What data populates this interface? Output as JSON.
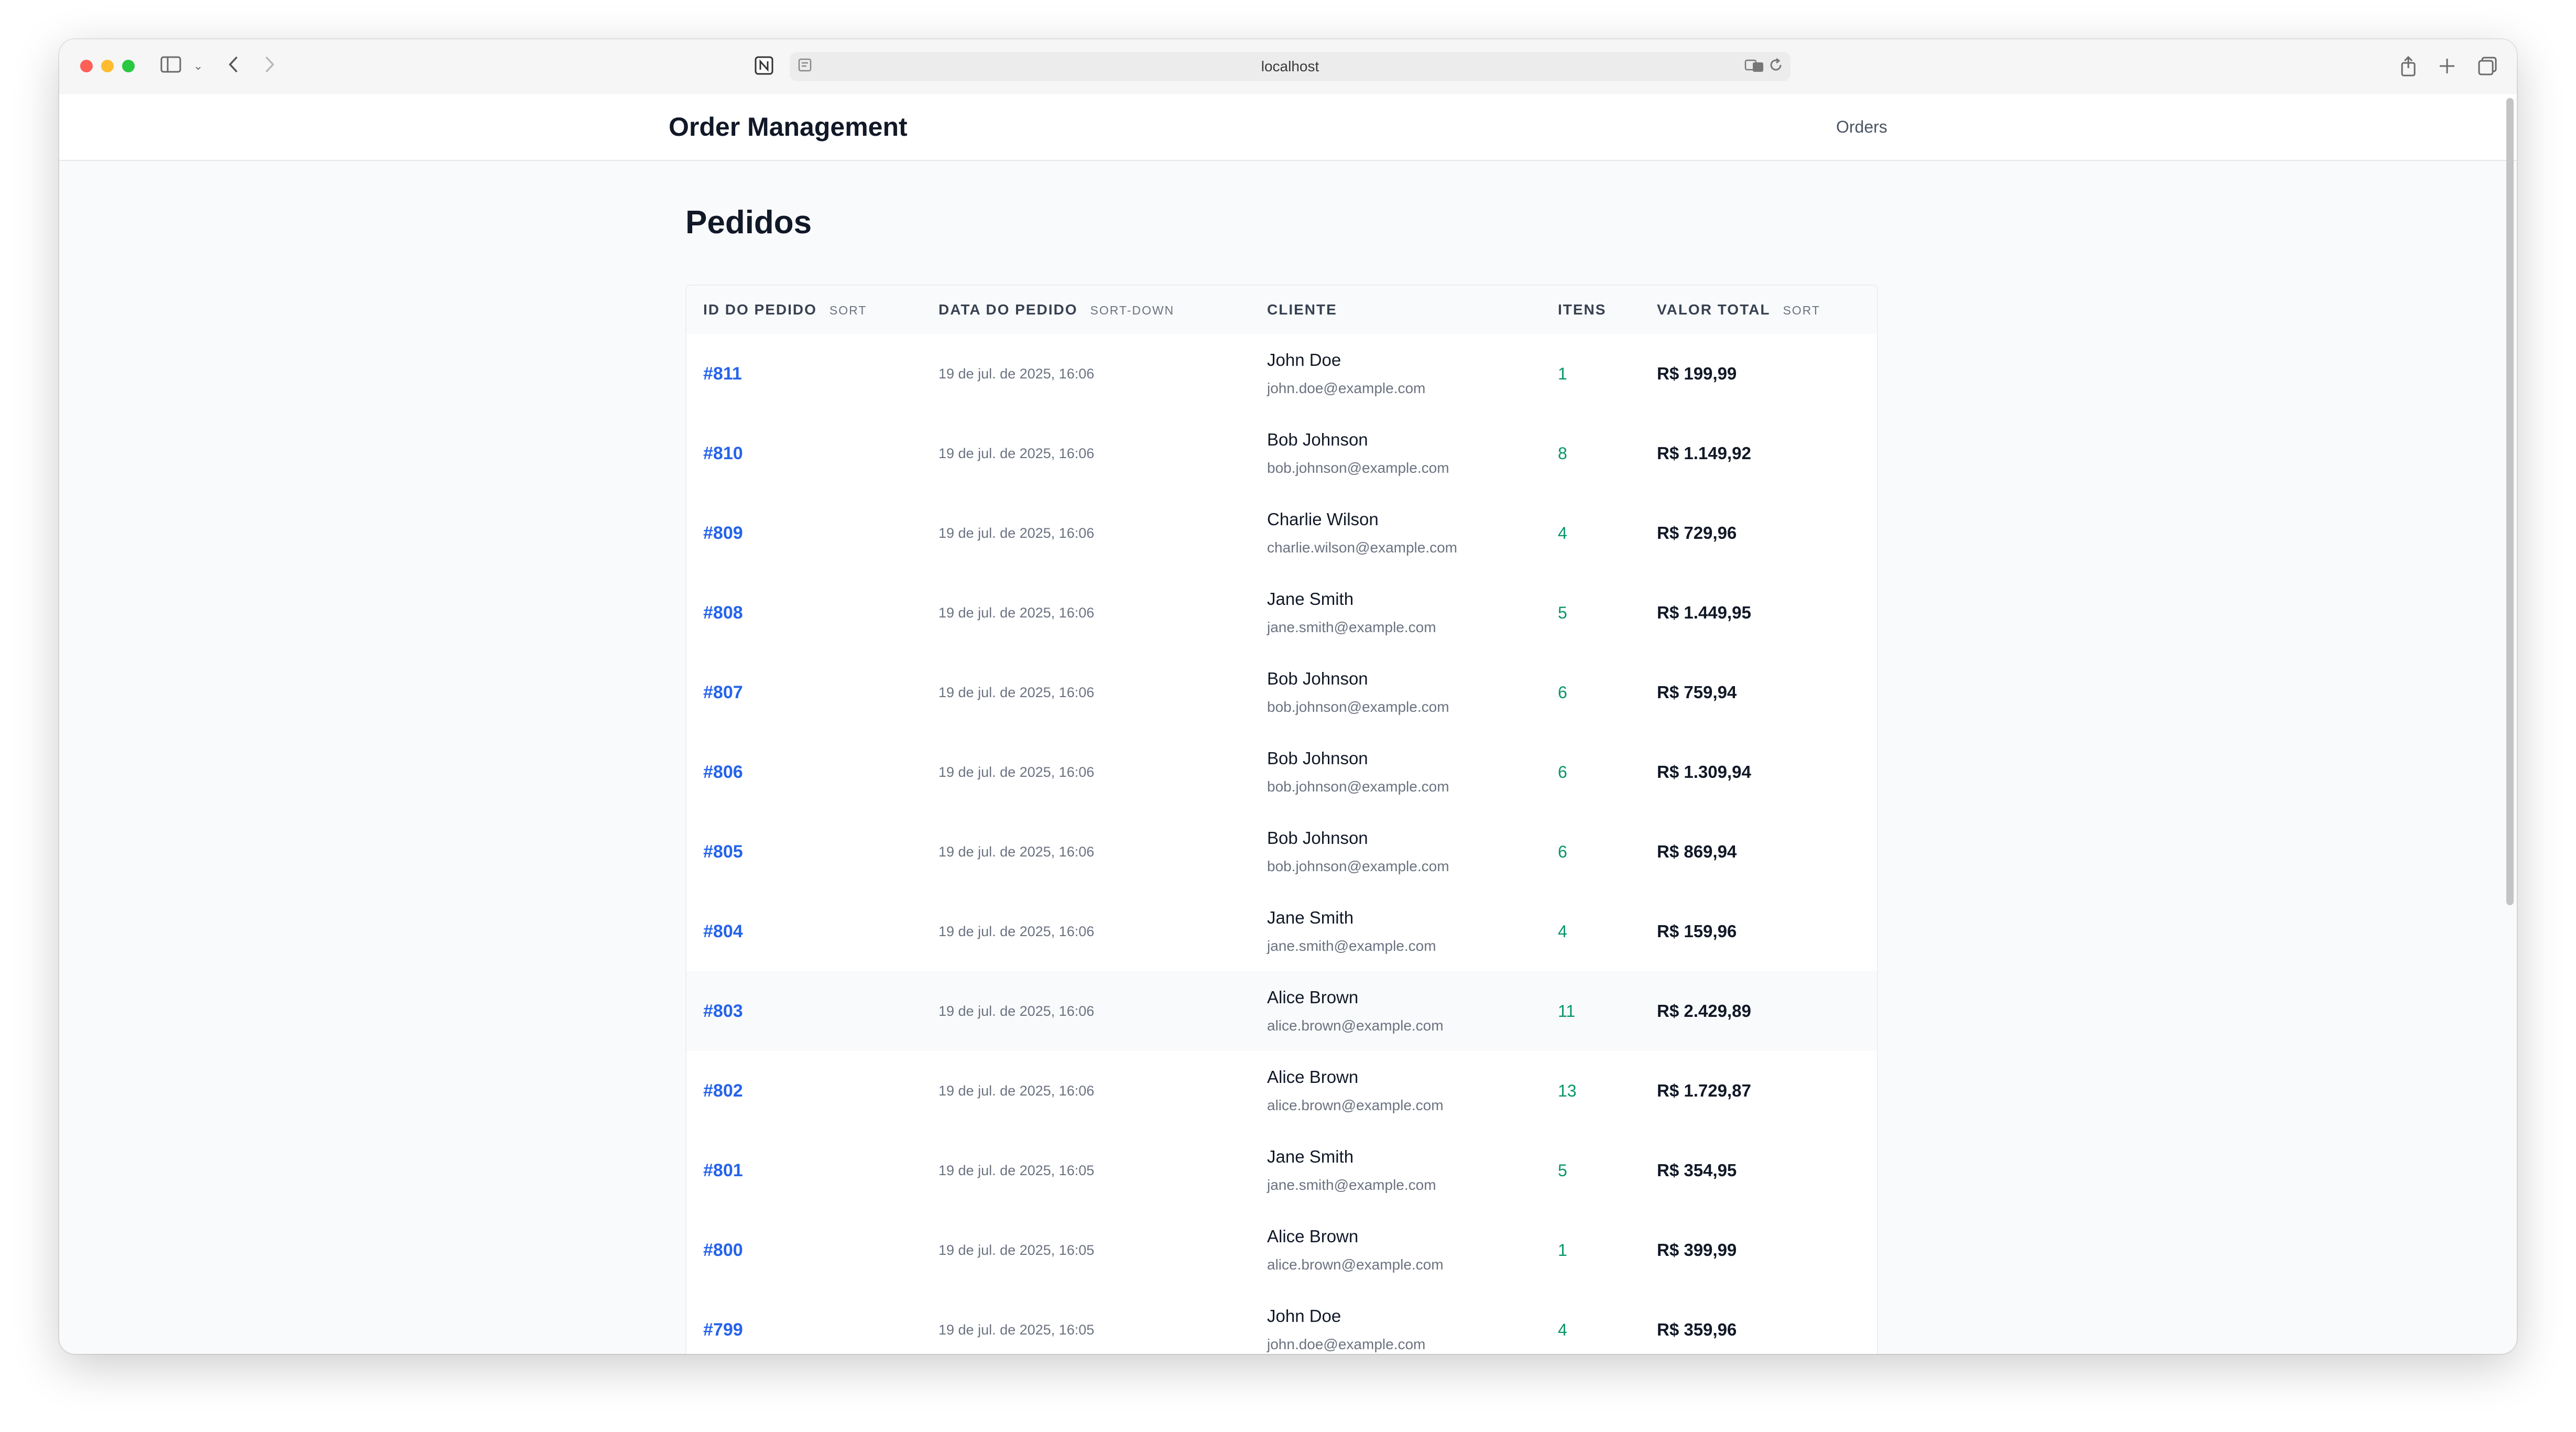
{
  "browser": {
    "url": "localhost"
  },
  "header": {
    "title": "Order Management",
    "nav_orders": "Orders"
  },
  "page": {
    "title": "Pedidos"
  },
  "table": {
    "columns": [
      {
        "label": "ID DO PEDIDO",
        "sort": "SORT"
      },
      {
        "label": "DATA DO PEDIDO",
        "sort": "SORT-DOWN"
      },
      {
        "label": "CLIENTE",
        "sort": ""
      },
      {
        "label": "ITENS",
        "sort": ""
      },
      {
        "label": "VALOR TOTAL",
        "sort": "SORT"
      }
    ],
    "rows": [
      {
        "id": "#811",
        "date": "19 de jul. de 2025, 16:06",
        "name": "John Doe",
        "email": "john.doe@example.com",
        "items": "1",
        "total": "R$ 199,99"
      },
      {
        "id": "#810",
        "date": "19 de jul. de 2025, 16:06",
        "name": "Bob Johnson",
        "email": "bob.johnson@example.com",
        "items": "8",
        "total": "R$ 1.149,92"
      },
      {
        "id": "#809",
        "date": "19 de jul. de 2025, 16:06",
        "name": "Charlie Wilson",
        "email": "charlie.wilson@example.com",
        "items": "4",
        "total": "R$ 729,96"
      },
      {
        "id": "#808",
        "date": "19 de jul. de 2025, 16:06",
        "name": "Jane Smith",
        "email": "jane.smith@example.com",
        "items": "5",
        "total": "R$ 1.449,95"
      },
      {
        "id": "#807",
        "date": "19 de jul. de 2025, 16:06",
        "name": "Bob Johnson",
        "email": "bob.johnson@example.com",
        "items": "6",
        "total": "R$ 759,94"
      },
      {
        "id": "#806",
        "date": "19 de jul. de 2025, 16:06",
        "name": "Bob Johnson",
        "email": "bob.johnson@example.com",
        "items": "6",
        "total": "R$ 1.309,94"
      },
      {
        "id": "#805",
        "date": "19 de jul. de 2025, 16:06",
        "name": "Bob Johnson",
        "email": "bob.johnson@example.com",
        "items": "6",
        "total": "R$ 869,94"
      },
      {
        "id": "#804",
        "date": "19 de jul. de 2025, 16:06",
        "name": "Jane Smith",
        "email": "jane.smith@example.com",
        "items": "4",
        "total": "R$ 159,96"
      },
      {
        "id": "#803",
        "date": "19 de jul. de 2025, 16:06",
        "name": "Alice Brown",
        "email": "alice.brown@example.com",
        "items": "11",
        "total": "R$ 2.429,89"
      },
      {
        "id": "#802",
        "date": "19 de jul. de 2025, 16:06",
        "name": "Alice Brown",
        "email": "alice.brown@example.com",
        "items": "13",
        "total": "R$ 1.729,87"
      },
      {
        "id": "#801",
        "date": "19 de jul. de 2025, 16:05",
        "name": "Jane Smith",
        "email": "jane.smith@example.com",
        "items": "5",
        "total": "R$ 354,95"
      },
      {
        "id": "#800",
        "date": "19 de jul. de 2025, 16:05",
        "name": "Alice Brown",
        "email": "alice.brown@example.com",
        "items": "1",
        "total": "R$ 399,99"
      },
      {
        "id": "#799",
        "date": "19 de jul. de 2025, 16:05",
        "name": "John Doe",
        "email": "john.doe@example.com",
        "items": "4",
        "total": "R$ 359,96"
      }
    ]
  }
}
